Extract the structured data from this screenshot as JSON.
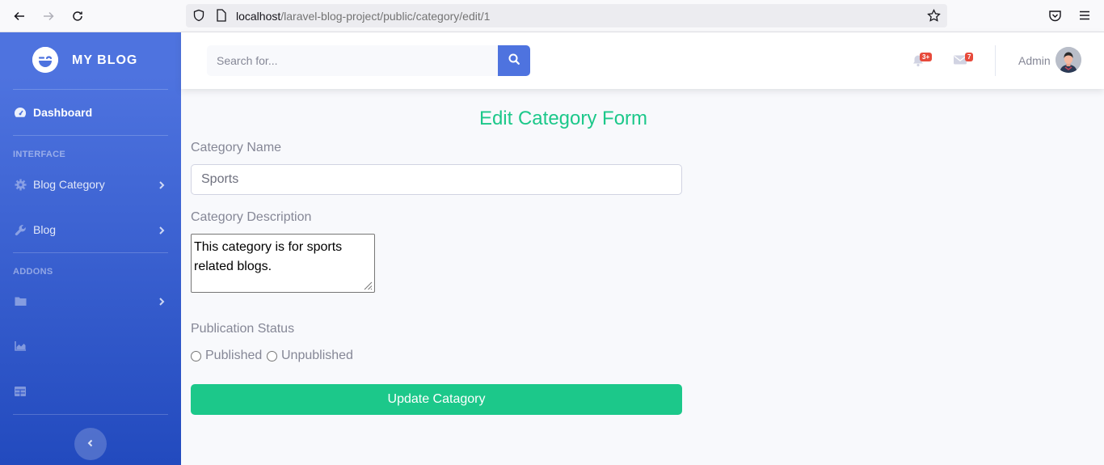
{
  "browser": {
    "url_host": "localhost",
    "url_path": "/laravel-blog-project/public/category/edit/1"
  },
  "sidebar": {
    "brand": "MY BLOG",
    "dashboard_label": "Dashboard",
    "heading_interface": "INTERFACE",
    "item_blog_category": "Blog Category",
    "item_blog": "Blog",
    "heading_addons": "ADDONS",
    "icons": [
      "folder-icon",
      "chart-area-icon",
      "table-icon"
    ]
  },
  "topbar": {
    "search_placeholder": "Search for...",
    "alerts_badge": "3+",
    "messages_badge": "7",
    "user_name": "Admin"
  },
  "form": {
    "title": "Edit Category Form",
    "name_label": "Category Name",
    "name_value": "Sports",
    "description_label": "Category Description",
    "description_value": "This category is for sports related blogs.",
    "status_label": "Publication Status",
    "option_published": "Published",
    "option_unpublished": "Unpublished",
    "submit_label": "Update Catagory"
  },
  "colors": {
    "primary": "#4e73df",
    "success": "#1cc88a",
    "danger": "#e74a3b"
  }
}
